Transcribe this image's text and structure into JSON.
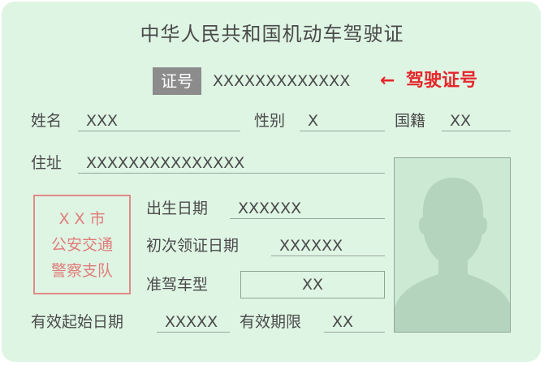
{
  "title": "中华人民共和国机动车驾驶证",
  "cert_no": {
    "label": "证号",
    "value": "XXXXXXXXXXXXX",
    "arrow": "←",
    "note": "驾驶证号"
  },
  "name": {
    "label": "姓名",
    "value": "XXX"
  },
  "sex": {
    "label": "性别",
    "value": "X"
  },
  "nationality": {
    "label": "国籍",
    "value": "XX"
  },
  "address": {
    "label": "住址",
    "value": "XXXXXXXXXXXXXXX"
  },
  "stamp": {
    "line1": "X X 市",
    "line2": "公安交通",
    "line3": "警察支队"
  },
  "birth": {
    "label": "出生日期",
    "value": "XXXXXX"
  },
  "first_issue": {
    "label": "初次领证日期",
    "value": "XXXXXX"
  },
  "vehicle_class": {
    "label": "准驾车型",
    "value": "XX"
  },
  "valid_from": {
    "label": "有效起始日期",
    "value": "XXXXX"
  },
  "valid_period": {
    "label": "有效期限",
    "value": "XX"
  },
  "colors": {
    "card_bg": "#dff5e4",
    "stamp": "#e07c7a",
    "highlight": "#e5262b",
    "badge": "#8c8c8c"
  }
}
